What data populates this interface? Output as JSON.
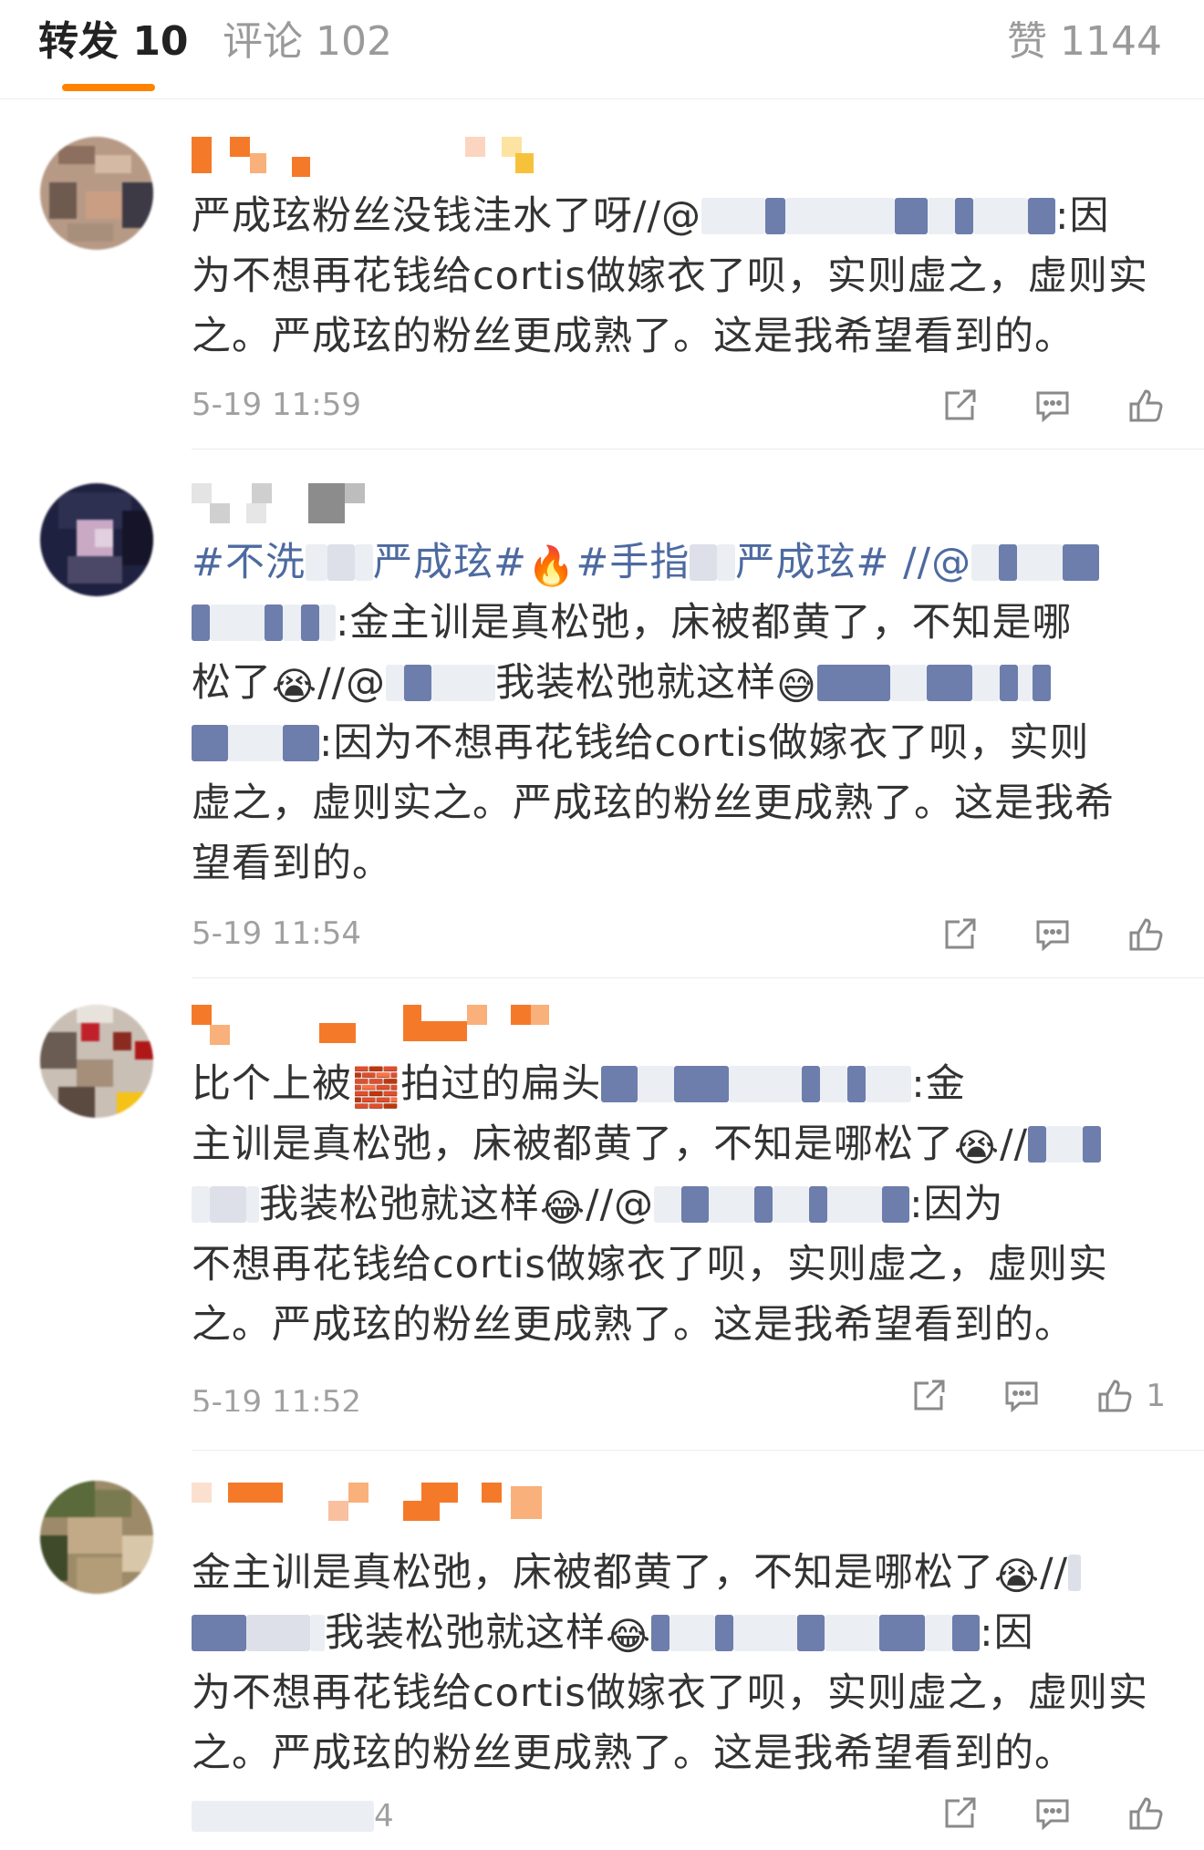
{
  "tabs": {
    "repost": "转发 10",
    "comment": "评论 102",
    "like": "赞 1144"
  },
  "colors": {
    "accent": "#ff8200",
    "hashtag": "#4d6aa0",
    "secondary_text": "#a0a0a0"
  },
  "icons": {
    "share": "share-icon",
    "comment": "comment-icon",
    "like": "like-icon"
  },
  "items": [
    {
      "lines": [
        [
          "严成玹粉丝没钱洼水了呀//@",
          ":因"
        ],
        [
          "为不想再花钱给cortis做嫁衣了呗，实则虚之，虚则实"
        ],
        [
          "之。严成玹的粉丝更成熟了。这是我希望看到的。"
        ]
      ],
      "time": "5-19 11:59",
      "like_count": ""
    },
    {
      "lines": [
        [
          "#不洗",
          "严成玹#",
          "#手指",
          "严成玹# //@"
        ],
        [
          ":金主训是真松弛，床被都黄了，不知是哪"
        ],
        [
          "松了",
          "//@",
          "我装松弛就这样",
          ""
        ],
        [
          ":因为不想再花钱给cortis做嫁衣了呗，实则"
        ],
        [
          "虚之，虚则实之。严成玹的粉丝更成熟了。这是我希"
        ],
        [
          "望看到的。"
        ]
      ],
      "time": "5-19 11:54",
      "like_count": ""
    },
    {
      "lines": [
        [
          "比个上被",
          "拍过的扁头",
          ":金"
        ],
        [
          "主训是真松弛，床被都黄了，不知是哪松了",
          "//"
        ],
        [
          "我装松弛就这样",
          "//@",
          ":因为"
        ],
        [
          "不想再花钱给cortis做嫁衣了呗，实则虚之，虚则实"
        ],
        [
          "之。严成玹的粉丝更成熟了。这是我希望看到的。"
        ]
      ],
      "time": "5-19 11:52",
      "like_count": "1"
    },
    {
      "lines": [
        [
          "金主训是真松弛，床被都黄了，不知是哪松了",
          "//"
        ],
        [
          "我装松弛就这样",
          ":因"
        ],
        [
          "为不想再花钱给cortis做嫁衣了呗，实则虚之，虚则实"
        ],
        [
          "之。严成玹的粉丝更成熟了。这是我希望看到的。"
        ]
      ],
      "time": "4",
      "like_count": ""
    }
  ]
}
